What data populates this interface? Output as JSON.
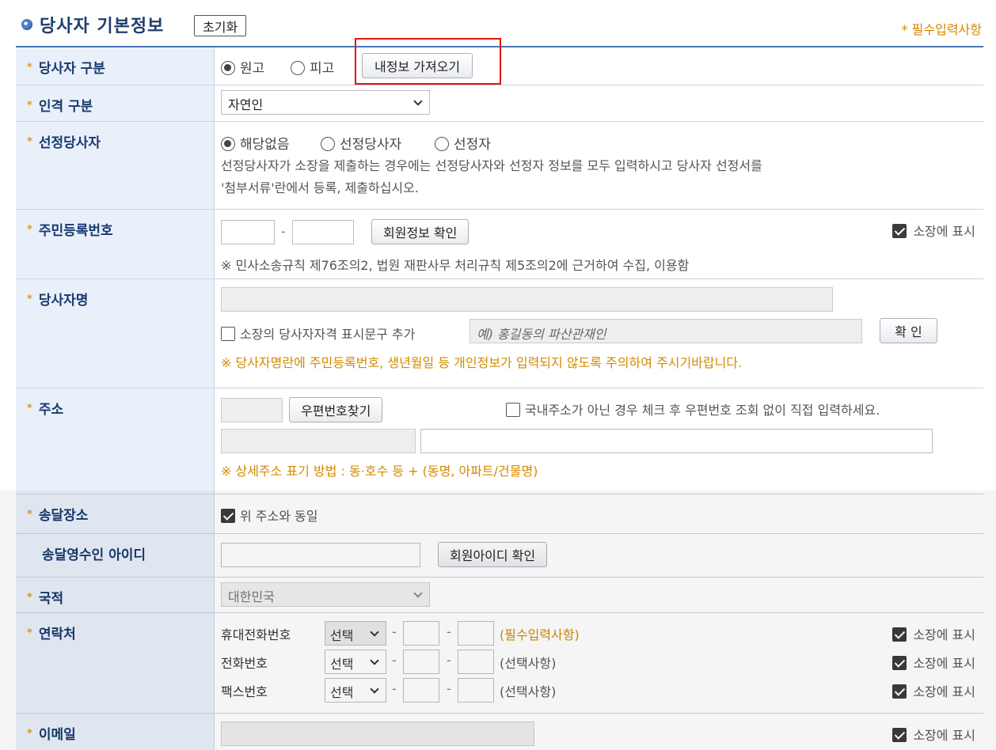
{
  "header": {
    "title": "당사자 기본정보",
    "reset_label": "초기화",
    "required_note": "* 필수입력사항"
  },
  "rows": {
    "party_type": {
      "label": "당사자 구분",
      "options": [
        "원고",
        "피고"
      ],
      "selected": "원고",
      "load_button": "내정보 가져오기"
    },
    "person_type": {
      "label": "인격 구분",
      "value": "자연인"
    },
    "designated": {
      "label": "선정당사자",
      "options": [
        "해당없음",
        "선정당사자",
        "선정자"
      ],
      "selected": "해당없음",
      "help_line1": "선정당사자가 소장을 제출하는 경우에는 선정당사자와 선정자 정보를 모두 입력하시고 당사자 선정서를",
      "help_line2": "'첨부서류'란에서 등록, 제출하십시오."
    },
    "rrn": {
      "label": "주민등록번호",
      "separator": "-",
      "verify_button": "회원정보 확인",
      "display_label": "소장에 표시",
      "note": "※ 민사소송규칙 제76조의2, 법원 재판사무 처리규칙 제5조의2에 근거하여 수집, 이용함"
    },
    "name": {
      "label": "당사자명",
      "qualifier_label": "소장의 당사자자격 표시문구 추가",
      "qualifier_placeholder": "예) 홍길동의 파산관재인",
      "confirm_button": "확 인",
      "warning": "※ 당사자명란에 주민등록번호, 생년월일 등 개인정보가 입력되지 않도록 주의하여 주시기바랍니다."
    },
    "address": {
      "label": "주소",
      "zip_button": "우편번호찾기",
      "foreign_label": "국내주소가 아닌 경우 체크 후 우편번호 조회 없이 직접 입력하세요.",
      "note": "※ 상세주소 표기 방법 : 동·호수 등 + (동명, 아파트/건물명)"
    },
    "delivery": {
      "label": "송달장소",
      "same_label": "위 주소와 동일"
    },
    "recipient_id": {
      "label": "송달영수인 아이디",
      "verify_button": "회원아이디 확인"
    },
    "nationality": {
      "label": "국적",
      "value": "대한민국"
    },
    "contact": {
      "label": "연락처",
      "lines": [
        {
          "name": "휴대전화번호",
          "select": "선택",
          "hint": "(필수입력사항)",
          "display": "소장에 표시"
        },
        {
          "name": "전화번호",
          "select": "선택",
          "hint": "(선택사항)",
          "display": "소장에 표시"
        },
        {
          "name": "팩스번호",
          "select": "선택",
          "hint": "(선택사항)",
          "display": "소장에 표시"
        }
      ]
    },
    "email": {
      "label": "이메일",
      "display_label": "소장에 표시"
    }
  },
  "colors": {
    "accent": "#1f3e6b",
    "label_bg": "#eaf0fa",
    "warning": "#d48a00",
    "highlight": "#e01515"
  }
}
